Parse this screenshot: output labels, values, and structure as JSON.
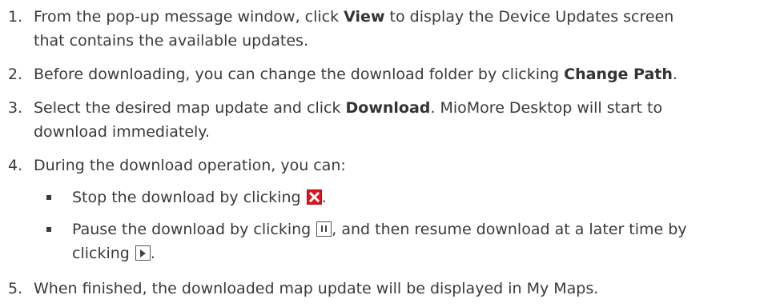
{
  "steps": [
    {
      "num": "1.",
      "a": "From the pop-up message window, click ",
      "b": "View",
      "c": " to display the Device Updates screen",
      "d": "that contains the available updates."
    },
    {
      "num": "2.",
      "a": "Before downloading, you can change the download folder by clicking ",
      "b": "Change Path",
      "c": "."
    },
    {
      "num": "3.",
      "a": "Select the desired map update and click ",
      "b": "Download",
      "c": ". MioMore Desktop will start to",
      "d": "download immediately."
    },
    {
      "num": "4.",
      "a": "During the download operation, you can:"
    },
    {
      "num": "5.",
      "a": "When finished, the downloaded map update will be displayed in My Maps."
    }
  ],
  "bullets": [
    {
      "a": "Stop the download by clicking ",
      "end": ".",
      "icon": "stop-icon"
    },
    {
      "a": "Pause the download by clicking ",
      "mid": ", and then resume download at a later time by",
      "b": "clicking ",
      "end": ".",
      "icons": [
        "pause-icon",
        "play-icon"
      ]
    }
  ],
  "colors": {
    "text": "#3a3a3a",
    "stop_icon": "#e0141c"
  }
}
